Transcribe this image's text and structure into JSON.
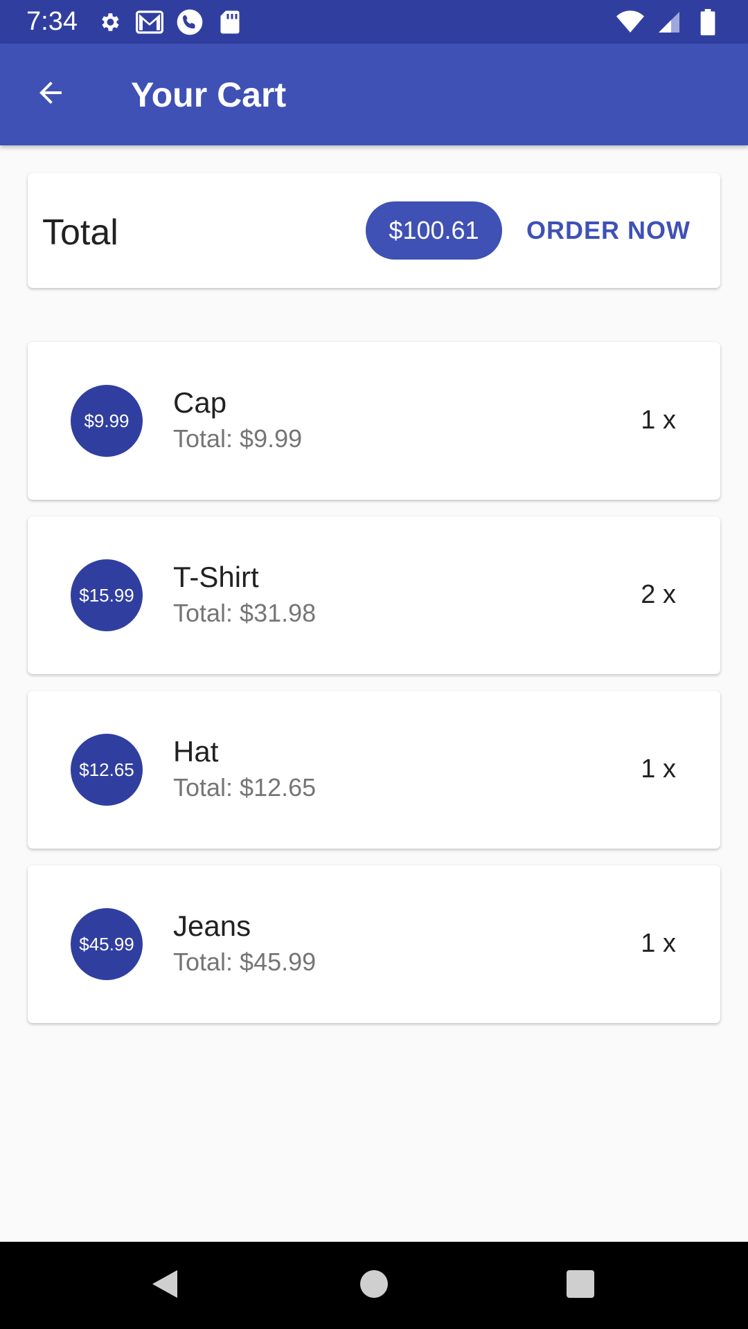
{
  "status_bar": {
    "time": "7:34",
    "left_icons": [
      "gear-icon",
      "gmail-icon",
      "phone-icon",
      "sd-card-icon"
    ],
    "right_icons": [
      "wifi-icon",
      "signal-icon",
      "battery-icon"
    ]
  },
  "app_bar": {
    "title": "Your Cart",
    "back_icon": "arrow-back-icon",
    "color": "#3f51b5",
    "status_color": "#303f9f"
  },
  "total": {
    "label": "Total",
    "amount": "$100.61",
    "order_button": "ORDER NOW"
  },
  "items": [
    {
      "price": "$9.99",
      "name": "Cap",
      "total": "Total: $9.99",
      "qty": "1 x"
    },
    {
      "price": "$15.99",
      "name": "T-Shirt",
      "total": "Total: $31.98",
      "qty": "2 x"
    },
    {
      "price": "$12.65",
      "name": "Hat",
      "total": "Total: $12.65",
      "qty": "1 x"
    },
    {
      "price": "$45.99",
      "name": "Jeans",
      "total": "Total: $45.99",
      "qty": "1 x"
    }
  ],
  "nav_bar": {
    "icons": [
      "back-triangle-icon",
      "home-circle-icon",
      "recents-square-icon"
    ]
  }
}
